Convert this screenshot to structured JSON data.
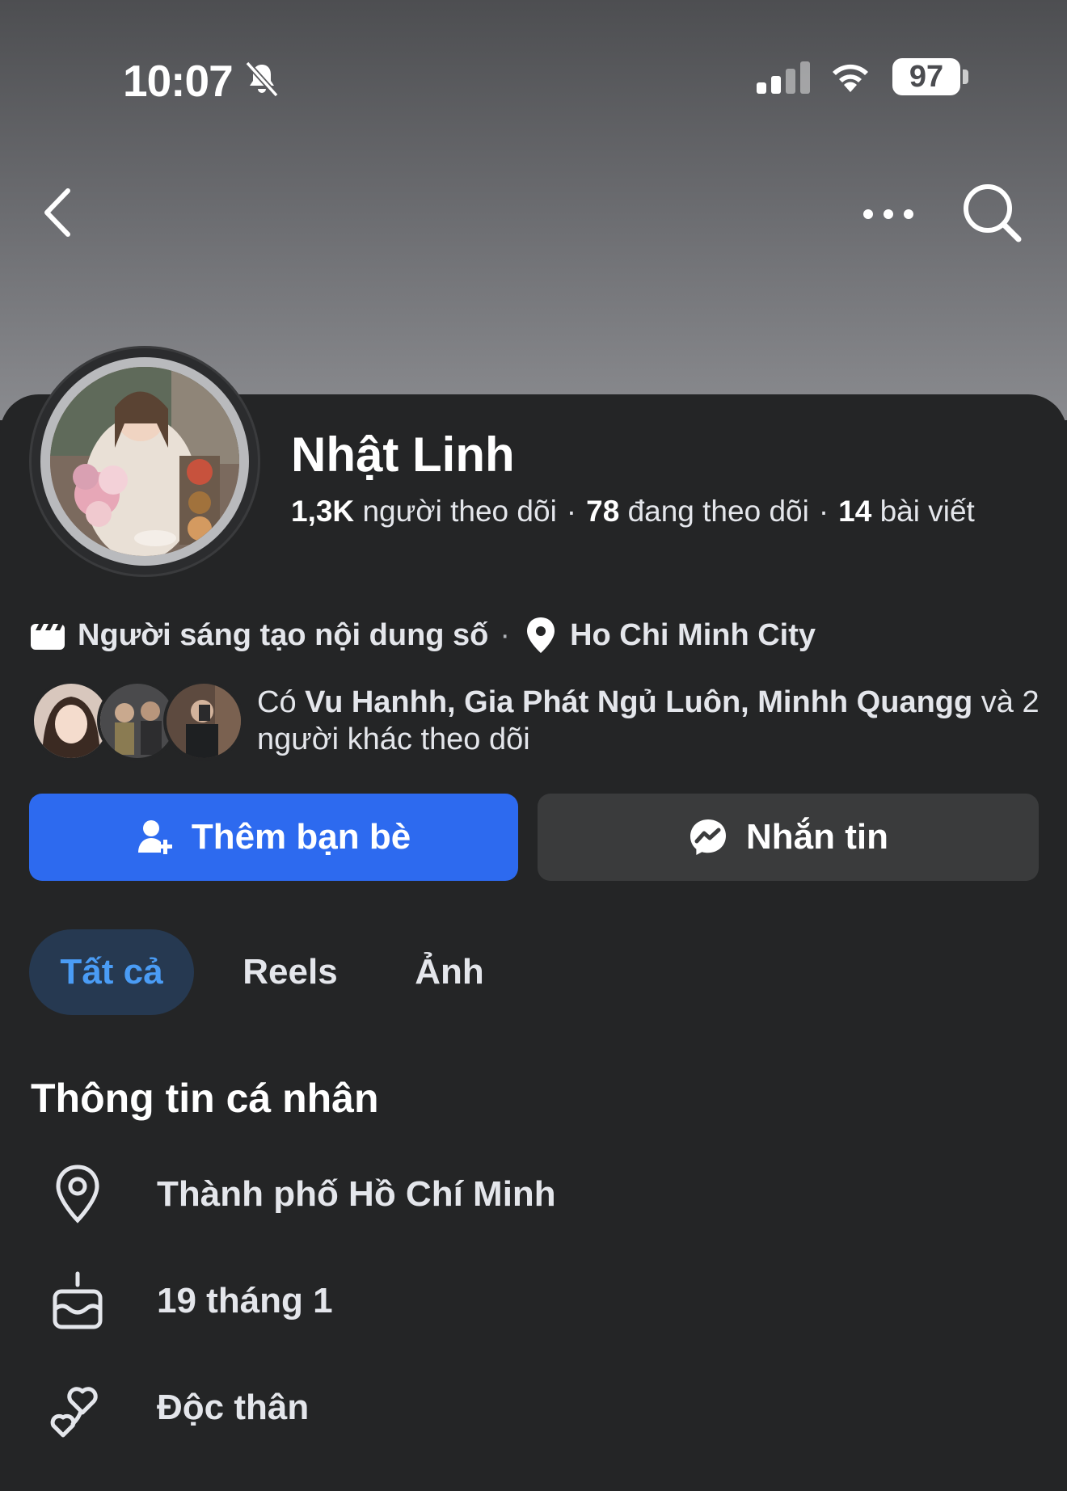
{
  "status_bar": {
    "time": "10:07",
    "battery": "97"
  },
  "profile": {
    "name": "Nhật Linh",
    "followers_count": "1,3K",
    "followers_label": "người theo dõi",
    "following_count": "78",
    "following_label": "đang theo dõi",
    "posts_count": "14",
    "posts_label": "bài viết",
    "separator": "·"
  },
  "meta": {
    "category": "Người sáng tạo nội dung số",
    "separator": "·",
    "location": "Ho Chi Minh City"
  },
  "mutual_followers": {
    "prefix": "Có",
    "names": "Vu Hanhh, Gia Phát Ngủ Luôn, Minhh Quangg",
    "conjunction": "và",
    "others": "2 người khác theo dõi"
  },
  "actions": {
    "add_friend": "Thêm bạn bè",
    "message": "Nhắn tin"
  },
  "tabs": [
    {
      "label": "Tất cả",
      "active": true
    },
    {
      "label": "Reels",
      "active": false
    },
    {
      "label": "Ảnh",
      "active": false
    }
  ],
  "personal_info": {
    "title": "Thông tin cá nhân",
    "items": [
      {
        "icon": "location-pin-icon",
        "text": "Thành phố Hồ Chí Minh"
      },
      {
        "icon": "birthday-cake-icon",
        "text": "19 tháng 1"
      },
      {
        "icon": "relationship-hearts-icon",
        "text": "Độc thân"
      }
    ]
  },
  "colors": {
    "background": "#242526",
    "primary_button": "#2d6aef",
    "secondary_button": "#3a3b3c",
    "active_tab_bg": "#263951",
    "active_tab_text": "#4a9cf5"
  }
}
